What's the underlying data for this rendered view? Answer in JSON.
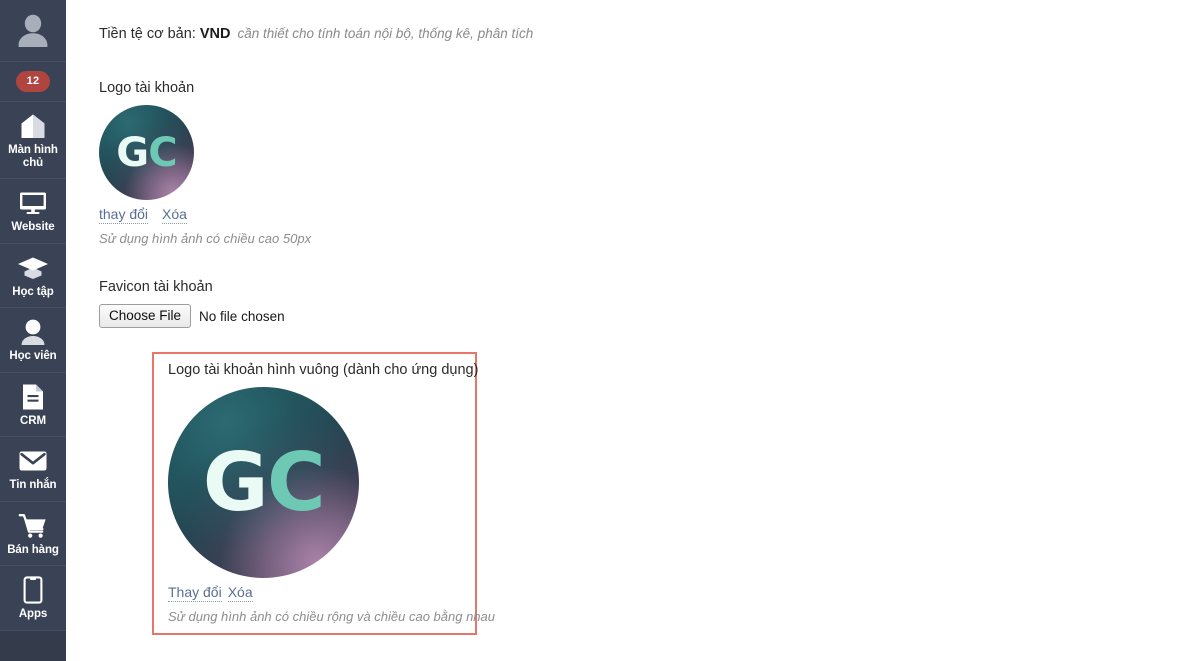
{
  "sidebar": {
    "avatar": {
      "name": "user-avatar"
    },
    "badge": {
      "count": "12"
    },
    "items": [
      {
        "icon": "home-icon",
        "label": "Màn hình chủ"
      },
      {
        "icon": "monitor-icon",
        "label": "Website"
      },
      {
        "icon": "graduation-cap-icon",
        "label": "Học tập"
      },
      {
        "icon": "person-icon",
        "label": "Học viên"
      },
      {
        "icon": "document-icon",
        "label": "CRM"
      },
      {
        "icon": "envelope-icon",
        "label": "Tin nhắn"
      },
      {
        "icon": "shopping-cart-icon",
        "label": "Bán hàng"
      },
      {
        "icon": "mobile-phone-icon",
        "label": "Apps"
      }
    ]
  },
  "main": {
    "currency": {
      "label": "Tiền tệ cơ bản:",
      "value": "VND",
      "note": "cần thiết cho tính toán nội bộ, thống kê, phân tích"
    },
    "account_logo": {
      "label": "Logo tài khoản",
      "image_alt": "GC",
      "logo_initials_first": "G",
      "logo_initials_second": "C",
      "change_link": "thay đổi",
      "delete_link": "Xóa",
      "hint": "Sử dụng hình ảnh có chiều cao 50px"
    },
    "favicon": {
      "label": "Favicon tài khoản",
      "button_label": "Choose File",
      "status_text": "No file chosen"
    },
    "square_logo": {
      "label": "Logo tài khoản hình vuông (dành cho ứng dụng)",
      "image_alt": "GC",
      "logo_initials_first": "G",
      "logo_initials_second": "C",
      "change_link": "Thay đổi",
      "delete_link": "Xóa",
      "hint": "Sử dụng hình ảnh có chiều rộng và chiều cao bằng nhau"
    }
  },
  "colors": {
    "sidebar_bg": "#3a4355",
    "badge_red": "#b0453f",
    "highlight_border": "#e8756a",
    "link_blue": "#5a6e92",
    "logo_teal": "#1d4d56",
    "logo_purple": "#a982a8",
    "logo_letter_g": "#e9fbf4",
    "logo_letter_c": "#6ec9b4"
  }
}
